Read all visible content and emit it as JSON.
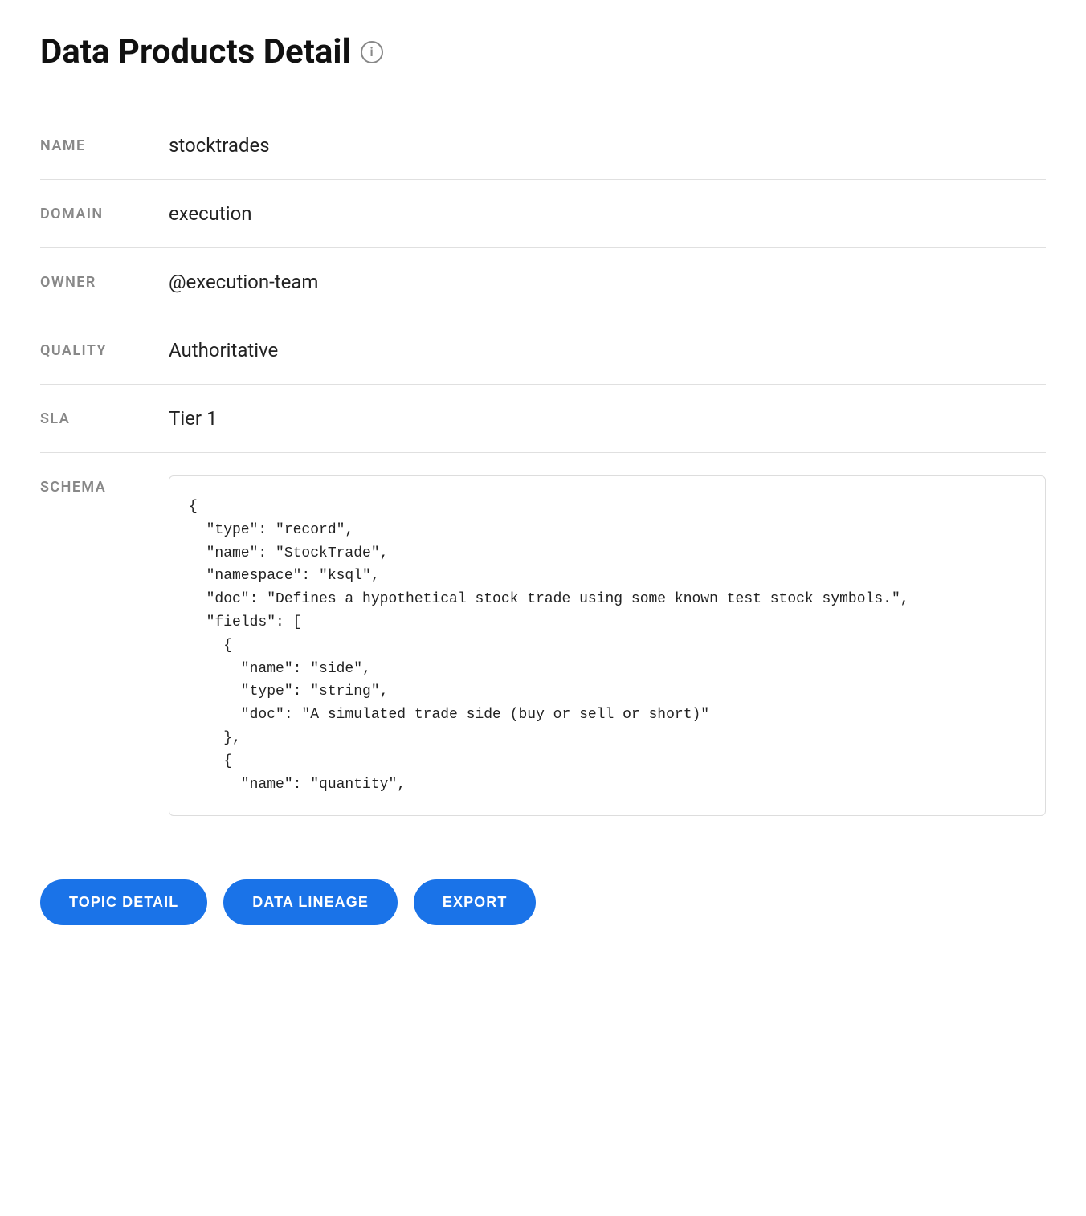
{
  "header": {
    "title": "Data Products Detail",
    "info_icon_label": "i"
  },
  "fields": {
    "name_label": "NAME",
    "name_value": "stocktrades",
    "domain_label": "DOMAIN",
    "domain_value": "execution",
    "owner_label": "OWNER",
    "owner_value": "@execution-team",
    "quality_label": "QUALITY",
    "quality_value": "Authoritative",
    "sla_label": "SLA",
    "sla_value": "Tier 1",
    "schema_label": "SCHEMA",
    "schema_value": "{\n  \"type\": \"record\",\n  \"name\": \"StockTrade\",\n  \"namespace\": \"ksql\",\n  \"doc\": \"Defines a hypothetical stock trade using some known test stock symbols.\",\n  \"fields\": [\n    {\n      \"name\": \"side\",\n      \"type\": \"string\",\n      \"doc\": \"A simulated trade side (buy or sell or short)\"\n    },\n    {\n      \"name\": \"quantity\","
  },
  "buttons": {
    "topic_detail": "TOPIC DETAIL",
    "data_lineage": "DATA LINEAGE",
    "export": "EXPORT"
  }
}
